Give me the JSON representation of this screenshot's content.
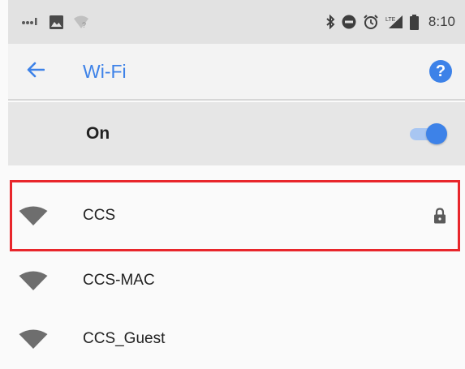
{
  "status_bar": {
    "time": "8:10",
    "left_icons": [
      "signal-dots-icon",
      "image-icon",
      "wifi-question-icon"
    ],
    "right_icons": [
      "bluetooth-icon",
      "do-not-disturb-icon",
      "alarm-icon",
      "lte-signal-icon",
      "battery-icon"
    ]
  },
  "app_bar": {
    "back_icon": "arrow-back-icon",
    "title": "Wi-Fi",
    "help_icon": "help-icon",
    "help_glyph": "?"
  },
  "wifi_switch": {
    "label": "On",
    "state": "on"
  },
  "networks": [
    {
      "name": "CCS",
      "secured": true,
      "highlighted": true
    },
    {
      "name": "CCS-MAC",
      "secured": false,
      "highlighted": false
    },
    {
      "name": "CCS_Guest",
      "secured": false,
      "highlighted": false
    }
  ],
  "colors": {
    "accent": "#3d82e8",
    "toggle_track": "#a8c6f2",
    "highlight": "#e8262b",
    "status_bar_bg": "#e2e2e2",
    "wifi_icon": "#6e6e6e"
  }
}
